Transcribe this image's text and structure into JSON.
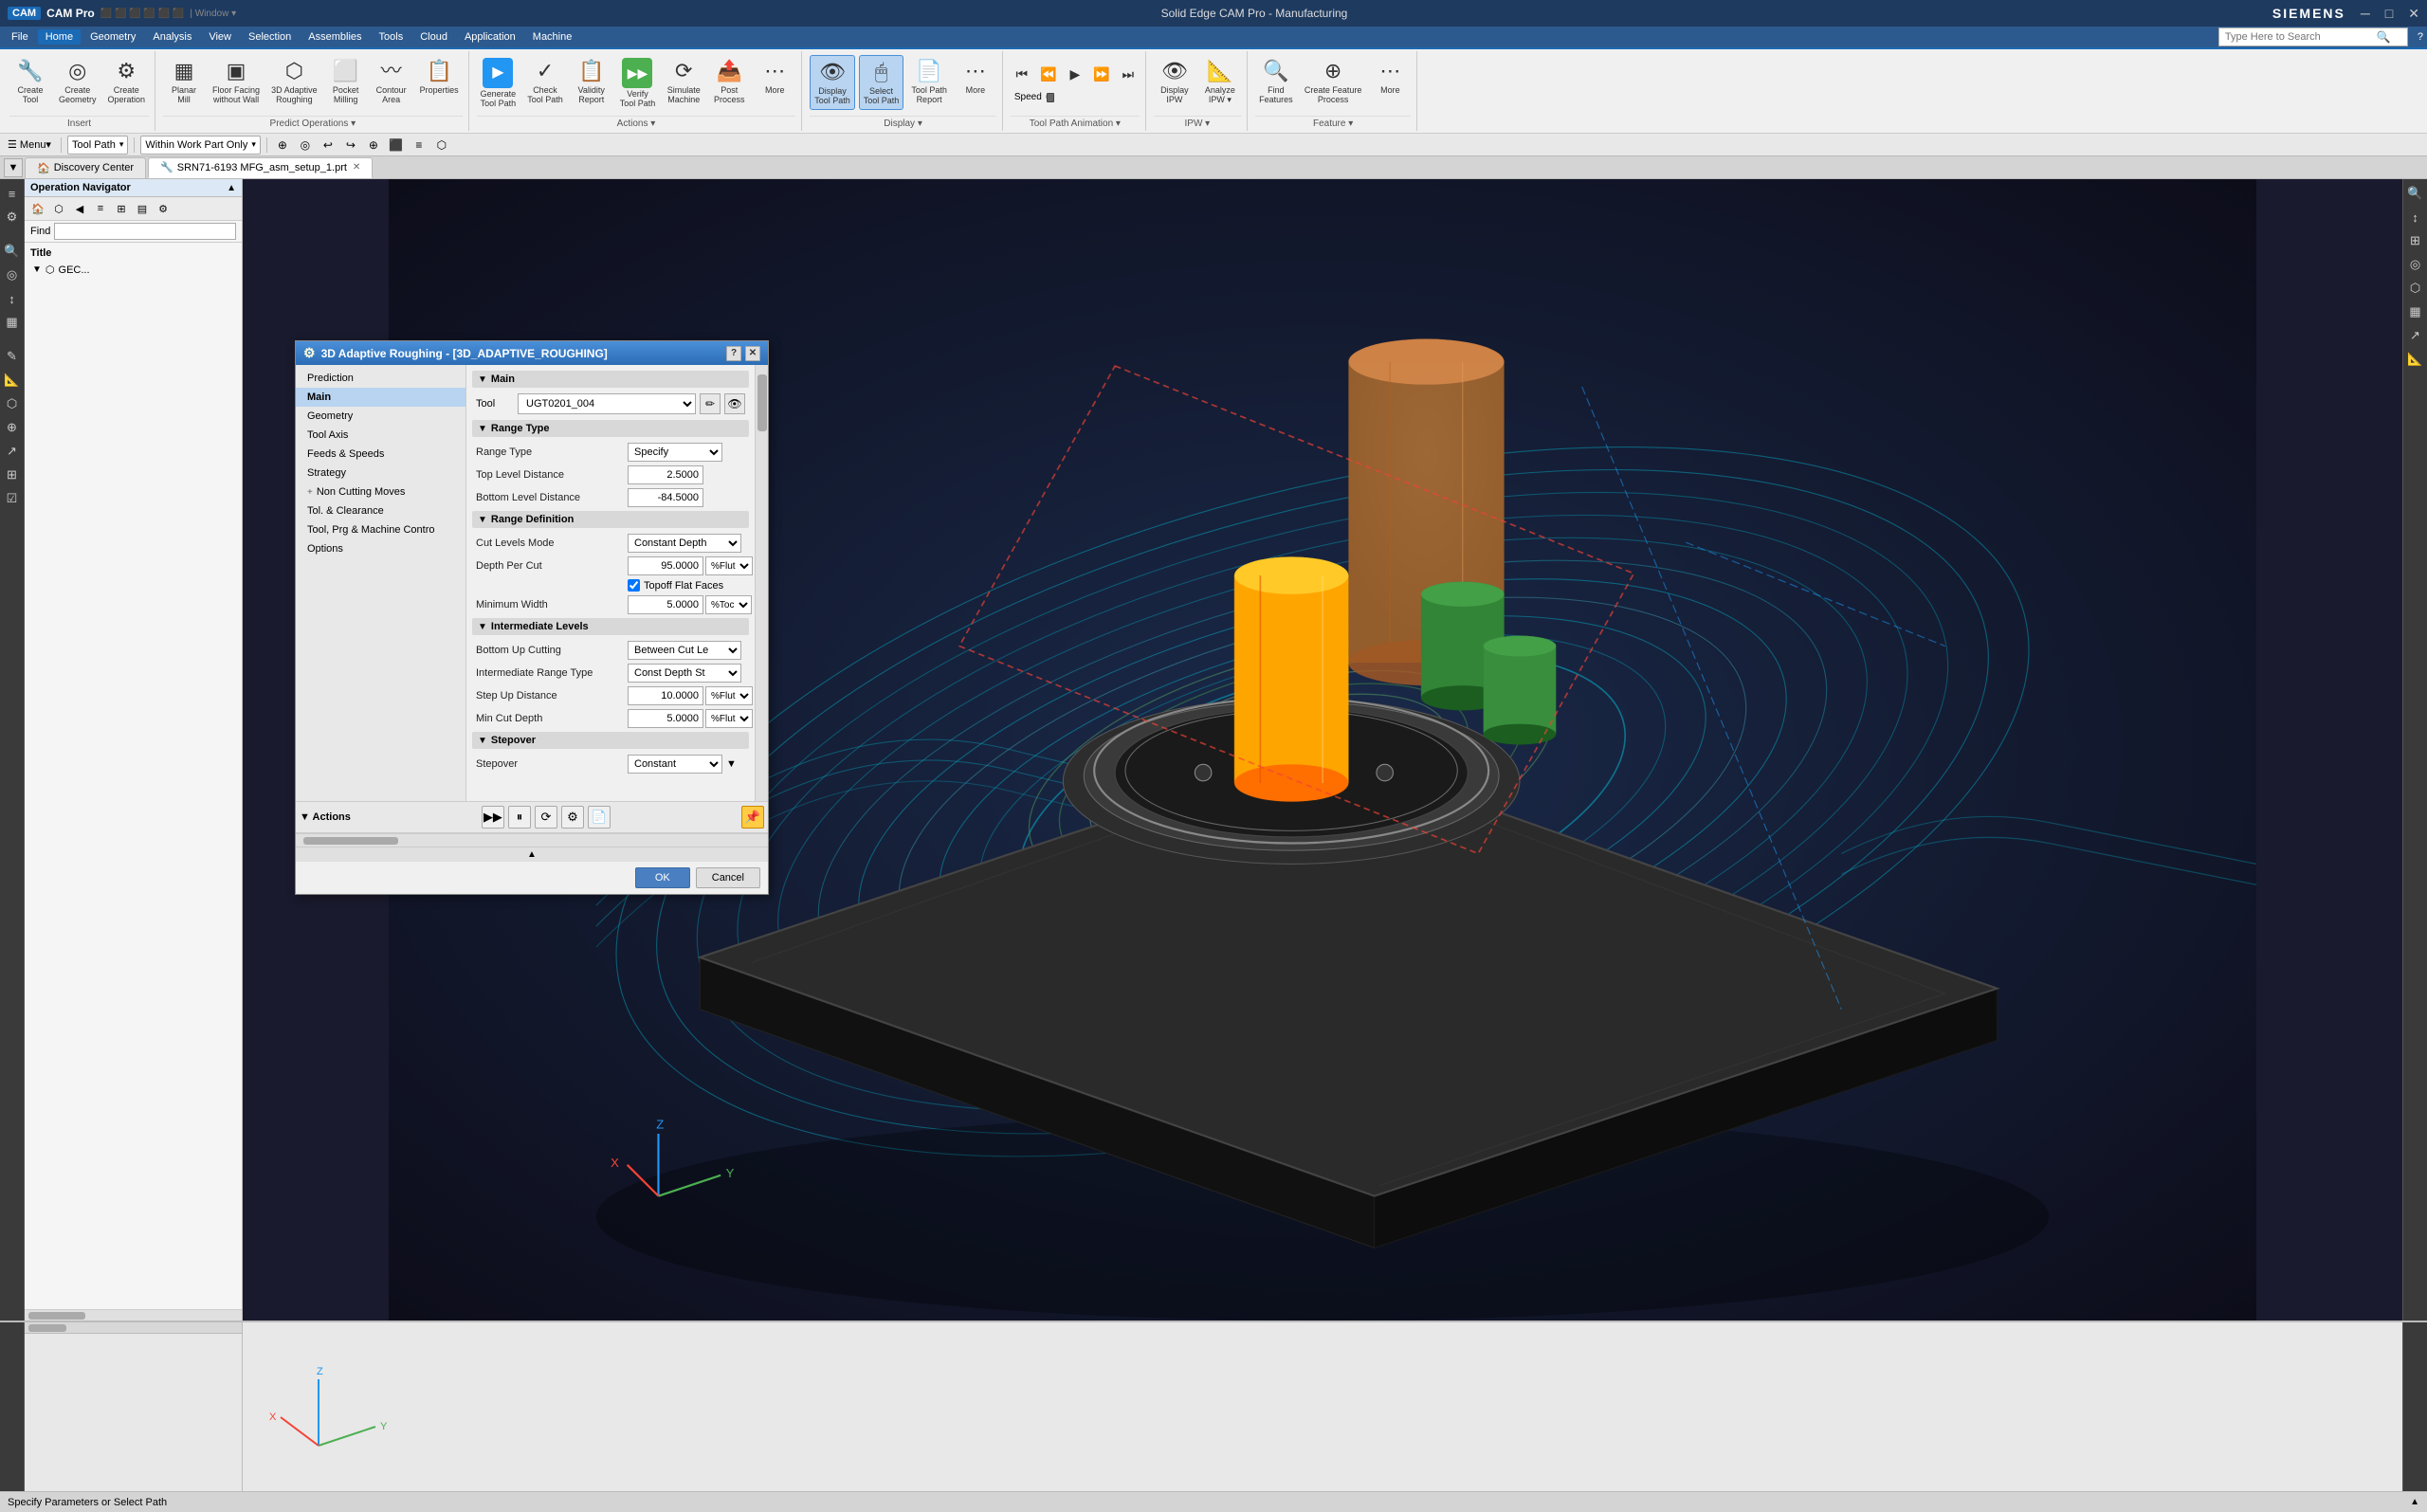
{
  "titleBar": {
    "appName": "CAM Pro",
    "windowTitle": "Solid Edge CAM Pro - Manufacturing",
    "brand": "SIEMENS",
    "winControls": [
      "—",
      "□",
      "✕"
    ]
  },
  "menuBar": {
    "items": [
      "File",
      "Home",
      "Geometry",
      "Analysis",
      "View",
      "Selection",
      "Assemblies",
      "Tools",
      "Cloud",
      "Application",
      "Machine"
    ]
  },
  "ribbon": {
    "groups": [
      {
        "label": "Insert",
        "buttons": [
          {
            "icon": "⊕",
            "label": "Create Tool"
          },
          {
            "icon": "◎",
            "label": "Create Geometry"
          },
          {
            "icon": "⚙",
            "label": "Create Operation"
          }
        ]
      },
      {
        "label": "Predict Operations",
        "buttons": [
          {
            "icon": "▦",
            "label": "Planar Mill"
          },
          {
            "icon": "▣",
            "label": "Floor Facing without Wall"
          },
          {
            "icon": "⬡",
            "label": "3D Adaptive Roughing"
          },
          {
            "icon": "⬜",
            "label": "Pocket Milling"
          },
          {
            "icon": "〰",
            "label": "Contour Area"
          },
          {
            "icon": "⚙",
            "label": "Properties"
          }
        ]
      },
      {
        "label": "Actions",
        "buttons": [
          {
            "icon": "▶",
            "label": "Generate Tool Path"
          },
          {
            "icon": "✓",
            "label": "Check Tool Path"
          },
          {
            "icon": "📋",
            "label": "Validity Report"
          },
          {
            "icon": "▶▶",
            "label": "Verify Tool Path"
          },
          {
            "icon": "⟳",
            "label": "Simulate Machine"
          },
          {
            "icon": "📤",
            "label": "Post Process"
          },
          {
            "icon": "⋯",
            "label": "More"
          }
        ]
      },
      {
        "label": "Display",
        "buttons": [
          {
            "icon": "👁",
            "label": "Display Tool Path",
            "active": true
          },
          {
            "icon": "🖱",
            "label": "Select Tool Path",
            "active": true
          },
          {
            "icon": "📄",
            "label": "Tool Path Report"
          },
          {
            "icon": "⋯",
            "label": "More"
          }
        ]
      },
      {
        "label": "Tool Path Animation",
        "buttons": [
          {
            "icon": "⏮",
            "label": ""
          },
          {
            "icon": "⏪",
            "label": ""
          },
          {
            "icon": "▶",
            "label": ""
          },
          {
            "icon": "⏩",
            "label": ""
          },
          {
            "icon": "⏭",
            "label": ""
          },
          {
            "icon": "─",
            "label": "Speed"
          }
        ]
      },
      {
        "label": "IPW",
        "buttons": [
          {
            "icon": "👁",
            "label": "Display IPW"
          },
          {
            "icon": "📐",
            "label": "Analyze IPW"
          }
        ]
      },
      {
        "label": "Feature",
        "buttons": [
          {
            "icon": "🔍",
            "label": "Find Features"
          },
          {
            "icon": "⊕",
            "label": "Create Feature Process"
          }
        ]
      }
    ]
  },
  "toolbar": {
    "mode": "Tool Path",
    "workPart": "Within Work Part Only",
    "moreOptions": "▼"
  },
  "tabs": [
    {
      "label": "Discovery Center",
      "active": false
    },
    {
      "label": "SRN71-6193 MFG_asm_setup_1.prt",
      "active": true
    }
  ],
  "operationNavigator": {
    "title": "Operation Navigator",
    "findLabel": "Find",
    "items": [
      {
        "label": "GEC...",
        "indent": 0
      }
    ]
  },
  "dialog": {
    "title": "3D Adaptive Roughing - [3D_ADAPTIVE_ROUGHING]",
    "icon": "⚙",
    "sidebar": {
      "items": [
        {
          "label": "Prediction",
          "active": false
        },
        {
          "label": "Main",
          "active": true
        },
        {
          "label": "Geometry",
          "active": false
        },
        {
          "label": "Tool Axis",
          "active": false
        },
        {
          "label": "Feeds & Speeds",
          "active": false
        },
        {
          "label": "Strategy",
          "active": false
        },
        {
          "label": "Non Cutting Moves",
          "active": false,
          "hasPlus": true
        },
        {
          "label": "Tol. & Clearance",
          "active": false
        },
        {
          "label": "Tool, Prg & Machine Control",
          "active": false
        },
        {
          "label": "Options",
          "active": false
        }
      ]
    },
    "sections": {
      "main": {
        "label": "Main",
        "tool": {
          "label": "Tool",
          "value": "UGT0201_004",
          "iconEdit": "✏",
          "iconView": "👁"
        }
      },
      "rangeType": {
        "label": "Range Type",
        "fields": [
          {
            "label": "Range Type",
            "type": "select",
            "value": "Specify"
          },
          {
            "label": "Top Level Distance",
            "type": "input",
            "value": "2.5000"
          },
          {
            "label": "Bottom Level Distance",
            "type": "input",
            "value": "-84.5000"
          }
        ]
      },
      "rangeDefinition": {
        "label": "Range Definition",
        "fields": [
          {
            "label": "Cut Levels Mode",
            "type": "select",
            "value": "Constant Depth"
          },
          {
            "label": "Depth Per Cut",
            "type": "input",
            "value": "95.0000",
            "unit": "%Flut"
          },
          {
            "label": "Topoff Flat Faces",
            "type": "checkbox",
            "checked": true
          },
          {
            "label": "Minimum Width",
            "type": "input",
            "value": "5.0000",
            "unit": "%Toc"
          }
        ]
      },
      "intermediateLevels": {
        "label": "Intermediate Levels",
        "fields": [
          {
            "label": "Bottom Up Cutting",
            "type": "select",
            "value": "Between Cut Le"
          },
          {
            "label": "Intermediate Range Type",
            "type": "select",
            "value": "Const Depth St"
          },
          {
            "label": "Step Up Distance",
            "type": "input",
            "value": "10.0000",
            "unit": "%Flut"
          },
          {
            "label": "Min Cut Depth",
            "type": "input",
            "value": "5.0000",
            "unit": "%Flut"
          }
        ]
      },
      "stepover": {
        "label": "Stepover",
        "fields": [
          {
            "label": "Stepover",
            "type": "select",
            "value": "Constant"
          }
        ]
      }
    },
    "actions": {
      "label": "Actions",
      "icons": [
        "▶▶",
        "⏸",
        "⟳",
        "⚙",
        "📄"
      ]
    },
    "buttons": {
      "ok": "OK",
      "cancel": "Cancel"
    }
  },
  "statusBar": {
    "text": "Specify Parameters or Select Path"
  }
}
